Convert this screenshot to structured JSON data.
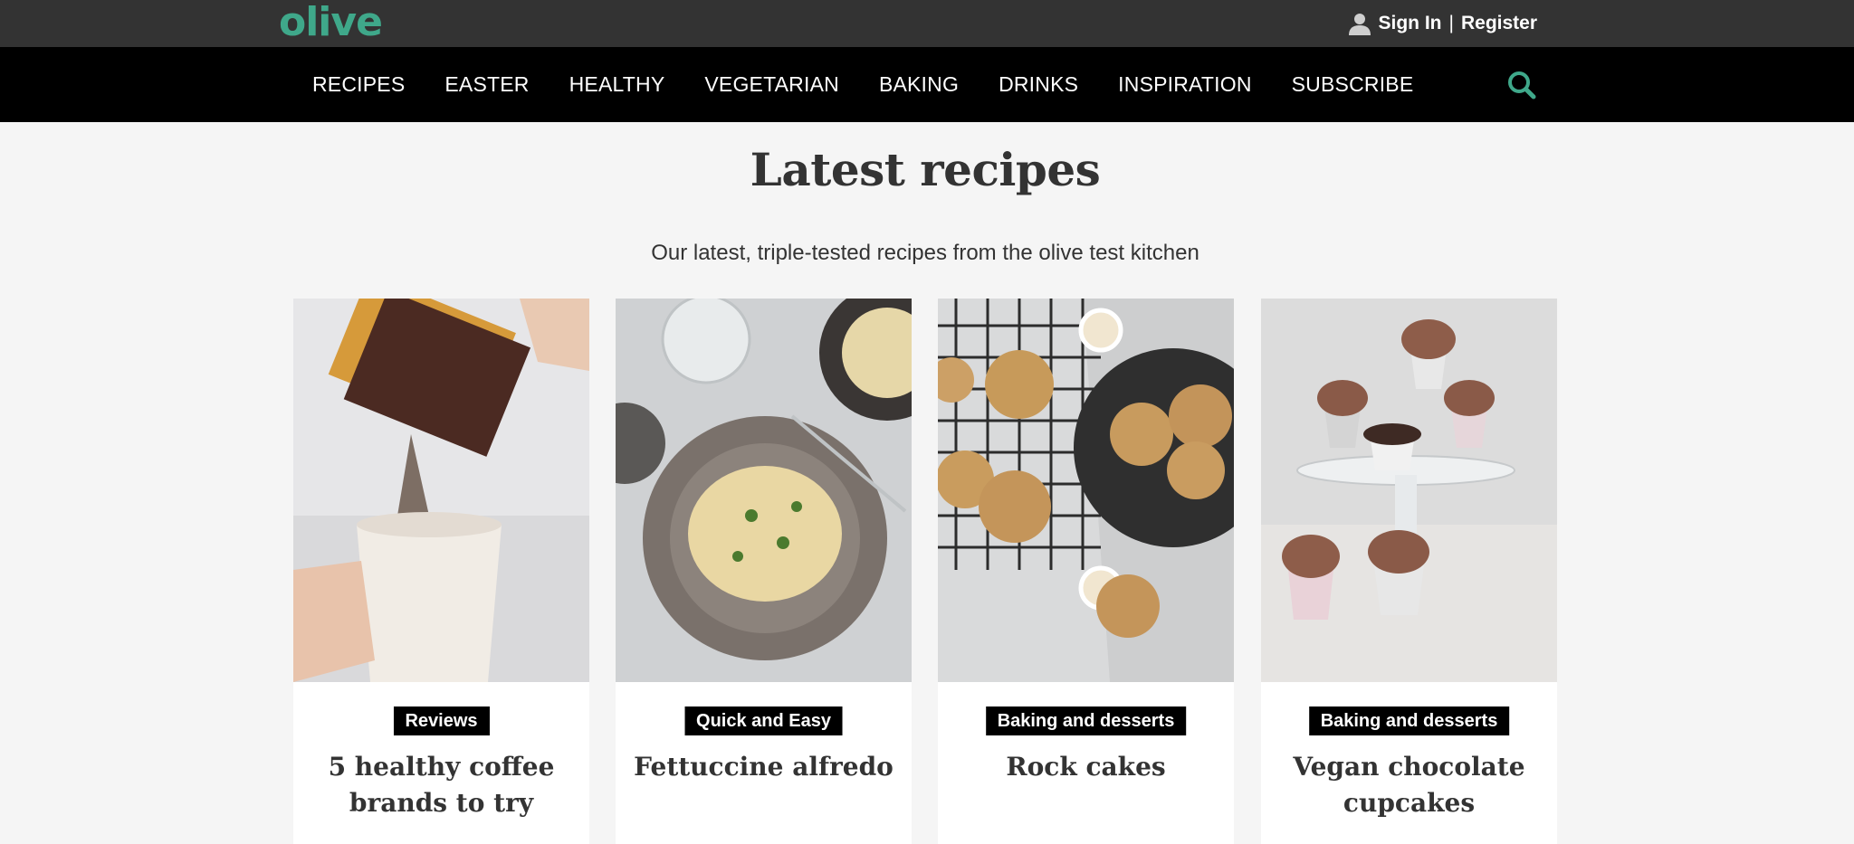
{
  "header": {
    "logo_text": "olive",
    "brand_color": "#3fa88a",
    "sign_in_label": "Sign In",
    "separator": "|",
    "register_label": "Register",
    "user_icon": "user-icon"
  },
  "nav": {
    "items": [
      {
        "label": "RECIPES"
      },
      {
        "label": "EASTER"
      },
      {
        "label": "HEALTHY"
      },
      {
        "label": "VEGETARIAN"
      },
      {
        "label": "BAKING"
      },
      {
        "label": "DRINKS"
      },
      {
        "label": "INSPIRATION"
      },
      {
        "label": "SUBSCRIBE"
      }
    ],
    "search_icon": "search-icon"
  },
  "main": {
    "title": "Latest recipes",
    "subtitle": "Our latest, triple-tested recipes from the olive test kitchen",
    "cards": [
      {
        "tag": "Reviews",
        "title": "5 healthy coffee brands to try"
      },
      {
        "tag": "Quick and Easy",
        "title": "Fettuccine alfredo"
      },
      {
        "tag": "Baking and desserts",
        "title": "Rock cakes"
      },
      {
        "tag": "Baking and desserts",
        "title": "Vegan chocolate cupcakes"
      }
    ]
  }
}
